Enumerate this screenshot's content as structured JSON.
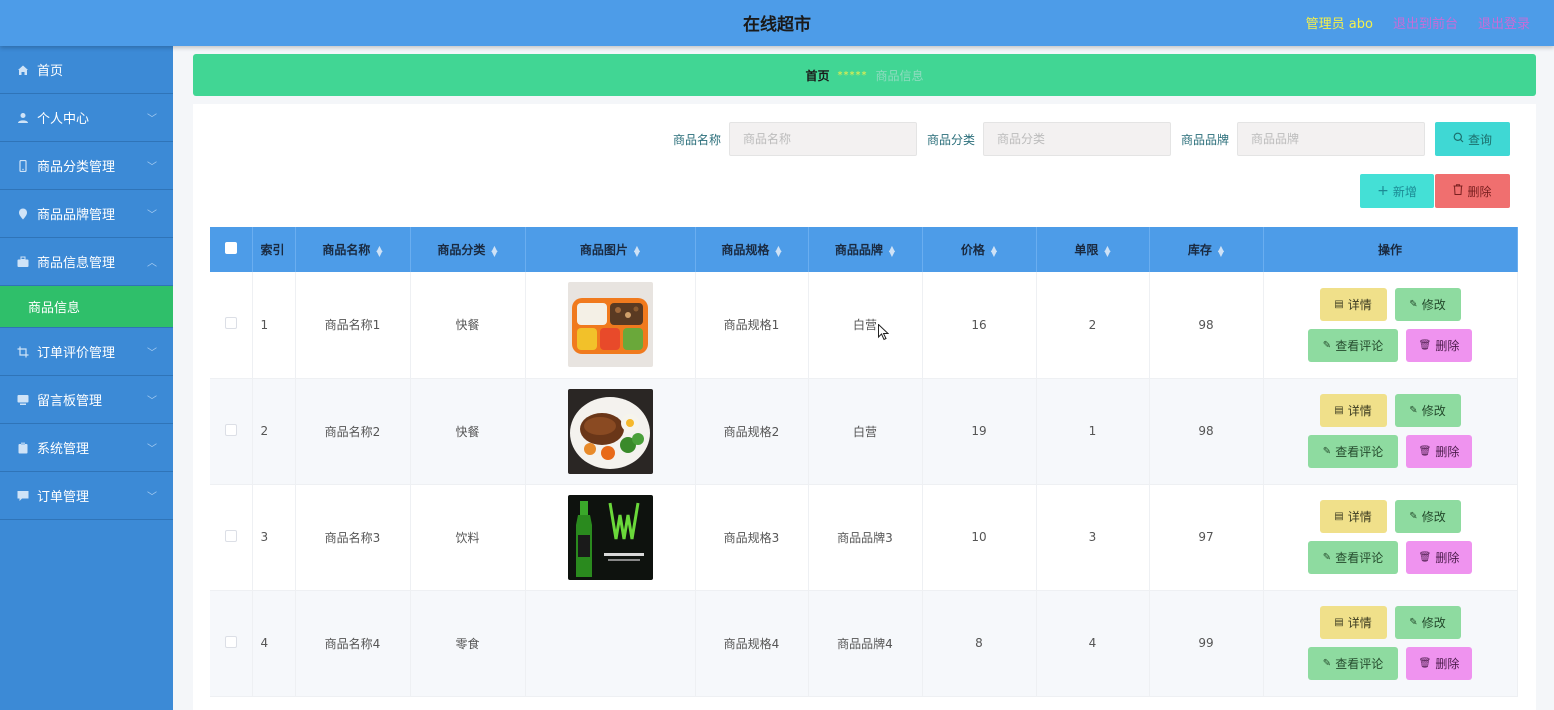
{
  "header": {
    "title": "在线超市",
    "admin": "管理员 abo",
    "link_front": "退出到前台",
    "link_logout": "退出登录"
  },
  "sidebar": {
    "items": [
      {
        "label": "首页",
        "icon": "home-icon",
        "expandable": false
      },
      {
        "label": "个人中心",
        "icon": "user-icon",
        "expandable": true
      },
      {
        "label": "商品分类管理",
        "icon": "mobile-icon",
        "expandable": true
      },
      {
        "label": "商品品牌管理",
        "icon": "location-icon",
        "expandable": true
      },
      {
        "label": "商品信息管理",
        "icon": "briefcase-icon",
        "expandable": true,
        "expanded": true
      },
      {
        "label": "订单评价管理",
        "icon": "crop-icon",
        "expandable": true
      },
      {
        "label": "留言板管理",
        "icon": "monitor-icon",
        "expandable": true
      },
      {
        "label": "系统管理",
        "icon": "clipboard-icon",
        "expandable": true
      },
      {
        "label": "订单管理",
        "icon": "chat-icon",
        "expandable": true
      }
    ],
    "active_sub": "商品信息"
  },
  "breadcrumb": {
    "home": "首页",
    "sep": "*****",
    "current": "商品信息"
  },
  "search": {
    "name_label": "商品名称",
    "name_placeholder": "商品名称",
    "category_label": "商品分类",
    "category_placeholder": "商品分类",
    "brand_label": "商品品牌",
    "brand_placeholder": "商品品牌",
    "query_label": "查询"
  },
  "actions": {
    "add_label": "新增",
    "delete_label": "删除"
  },
  "table": {
    "headers": {
      "index": "索引",
      "name": "商品名称",
      "category": "商品分类",
      "image": "商品图片",
      "spec": "商品规格",
      "brand": "商品品牌",
      "price": "价格",
      "limit": "单限",
      "stock": "库存",
      "ops": "操作"
    },
    "ops": {
      "detail": "详情",
      "edit": "修改",
      "review": "查看评论",
      "delete": "删除"
    },
    "rows": [
      {
        "index": "1",
        "name": "商品名称1",
        "category": "快餐",
        "image": "bento-box",
        "spec": "商品规格1",
        "brand": "白营",
        "price": "16",
        "limit": "2",
        "stock": "98"
      },
      {
        "index": "2",
        "name": "商品名称2",
        "category": "快餐",
        "image": "rice-bowl",
        "spec": "商品规格2",
        "brand": "白营",
        "price": "19",
        "limit": "1",
        "stock": "98"
      },
      {
        "index": "3",
        "name": "商品名称3",
        "category": "饮料",
        "image": "monster-energy-drink",
        "spec": "商品规格3",
        "brand": "商品品牌3",
        "price": "10",
        "limit": "3",
        "stock": "97"
      },
      {
        "index": "4",
        "name": "商品名称4",
        "category": "零食",
        "image": "",
        "spec": "商品规格4",
        "brand": "商品品牌4",
        "price": "8",
        "limit": "4",
        "stock": "99"
      }
    ]
  },
  "colors": {
    "header_bg": "#4d9ce8",
    "sidebar_bg": "#3c8ad6",
    "active_sub_bg": "#2fbf6a",
    "breadcrumb_bg": "#41d694"
  }
}
